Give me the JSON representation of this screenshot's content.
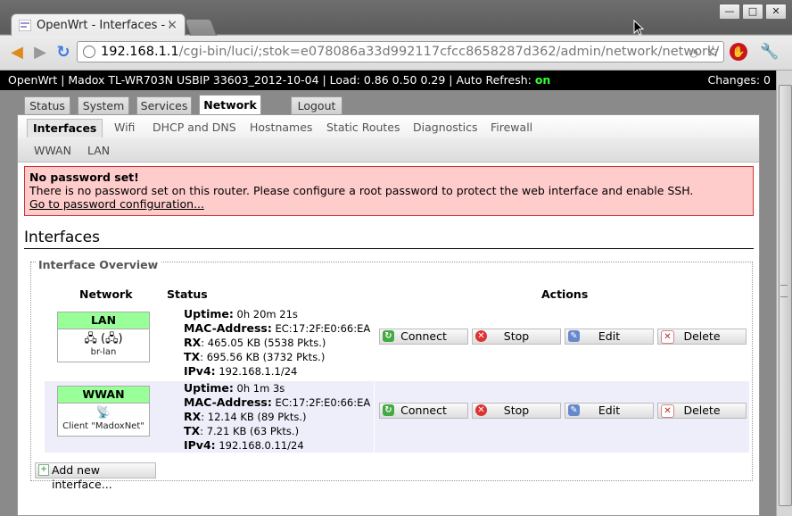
{
  "browser": {
    "tab_title": "OpenWrt - Interfaces - L",
    "tab_close": "×",
    "url_host": "192.168.1.1",
    "url_path": "/cgi-bin/luci/;stok=e078086a33d992117cfcc8658287d362/admin/network/network/",
    "window_buttons": [
      "—",
      "□",
      "✕"
    ],
    "icons": [
      "back-icon",
      "forward-icon",
      "reload-icon",
      "globe-icon",
      "star-icon",
      "stop-extension-icon",
      "wrench-icon"
    ]
  },
  "topbar": {
    "info_prefix": "OpenWrt | Madox TL-WR703N USBIP 33603_2012-10-04 | Load: 0.86 0.50 0.29 | Auto Refresh: ",
    "auto_refresh": "on",
    "changes": "Changes: 0"
  },
  "main_tabs": [
    "Status",
    "System",
    "Services",
    "Network",
    "Logout"
  ],
  "sub_tabs": [
    "Interfaces",
    "Wifi",
    "DHCP and DNS",
    "Hostnames",
    "Static Routes",
    "Diagnostics",
    "Firewall"
  ],
  "iface_tabs": [
    "WWAN",
    "LAN"
  ],
  "alert": {
    "title": "No password set!",
    "body": "There is no password set on this router. Please configure a root password to protect the web interface and enable SSH.",
    "link": "Go to password configuration..."
  },
  "page_title": "Interfaces",
  "overview": {
    "legend": "Interface Overview",
    "headers": {
      "network": "Network",
      "status": "Status",
      "actions": "Actions"
    },
    "rows": [
      {
        "name": "LAN",
        "icons": "🖧 (🖧)",
        "device": "br-lan",
        "uptime_label": "Uptime:",
        "uptime": "0h 20m 21s",
        "mac_label": "MAC-Address:",
        "mac": "EC:17:2F:E0:66:EA",
        "rx_label": "RX",
        "rx": ": 465.05 KB (5538 Pkts.)",
        "tx_label": "TX",
        "tx": ": 695.56 KB (3732 Pkts.)",
        "ipv4_label": "IPv4:",
        "ipv4": "192.168.1.1/24"
      },
      {
        "name": "WWAN",
        "icons": "📡",
        "device": "Client \"MadoxNet\"",
        "uptime_label": "Uptime:",
        "uptime": "0h 1m 3s",
        "mac_label": "MAC-Address:",
        "mac": "EC:17:2F:E0:66:EA",
        "rx_label": "RX",
        "rx": ": 12.14 KB (89 Pkts.)",
        "tx_label": "TX",
        "tx": ": 7.21 KB (63 Pkts.)",
        "ipv4_label": "IPv4:",
        "ipv4": "192.168.0.11/24"
      }
    ],
    "buttons": {
      "connect": "Connect",
      "stop": "Stop",
      "edit": "Edit",
      "delete": "Delete"
    },
    "add_button": "Add new interface..."
  }
}
